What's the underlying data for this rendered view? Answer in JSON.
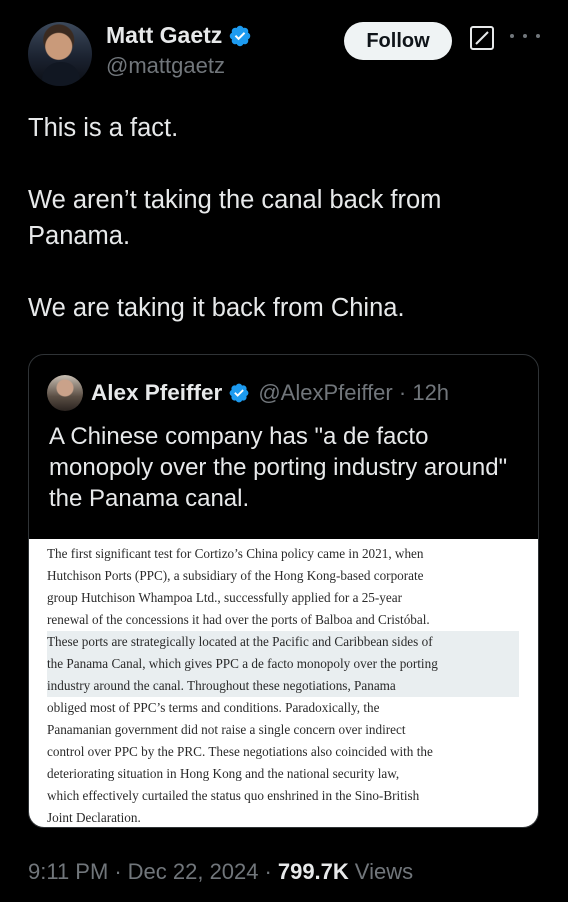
{
  "author": {
    "name": "Matt Gaetz",
    "handle": "@mattgaetz",
    "follow_label": "Follow"
  },
  "tweet": {
    "lines": [
      "This is a fact.",
      "We aren’t taking the canal back from Panama.",
      "We are taking it back from China."
    ]
  },
  "quote": {
    "name": "Alex Pfeiffer",
    "handle": "@AlexPfeiffer",
    "separator": "·",
    "time": "12h",
    "text": "A Chinese company has \"a de facto monopoly over the porting industry around\" the Panama canal.",
    "article_lines": [
      "The first significant test for Cortizo’s China policy came in 2021, when",
      "Hutchison Ports (PPC), a subsidiary of the Hong Kong-based corporate",
      "group Hutchison Whampoa Ltd., successfully applied for a 25-year",
      "renewal of the concessions it had over the ports of Balboa and Cristóbal.",
      "These ports are strategically located at the Pacific and Caribbean sides of",
      "the Panama Canal, which gives PPC a de facto monopoly over the porting",
      "industry around the canal. Throughout these negotiations, Panama",
      "obliged most of PPC’s terms and conditions. Paradoxically, the",
      "Panamanian government did not raise a single concern over indirect",
      "control over PPC by the PRC. These negotiations also coincided with the",
      "deteriorating situation in Hong Kong and the national security law,",
      "which effectively curtailed the status quo enshrined in the Sino-British",
      "Joint Declaration."
    ]
  },
  "footer": {
    "time": "9:11 PM",
    "separator": "·",
    "date": "Dec 22, 2024",
    "views_count": "799.7K",
    "views_label": "Views"
  },
  "colors": {
    "background": "#000000",
    "text": "#e7e9ea",
    "secondary": "#71767b",
    "verified": "#1d9bf0",
    "border": "#2f3336"
  }
}
